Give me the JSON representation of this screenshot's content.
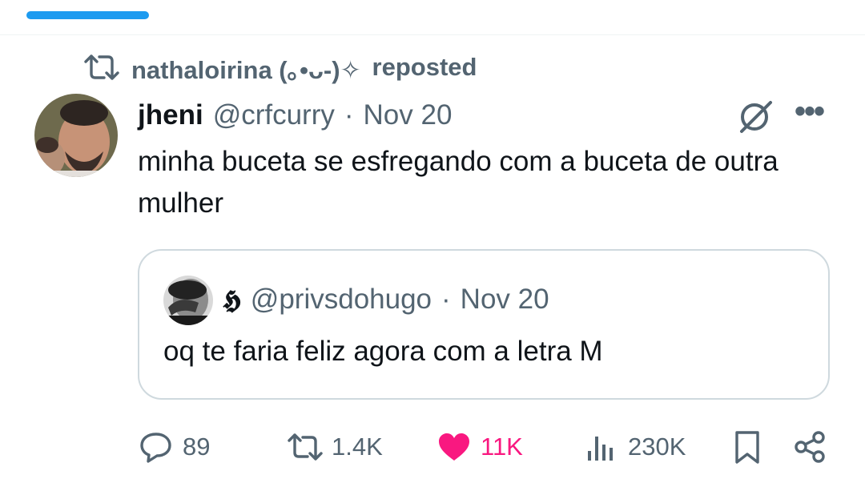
{
  "repost": {
    "reposter": "nathaloirina (｡•ᴗ-)✧",
    "label": "reposted"
  },
  "tweet": {
    "display_name": "jheni",
    "handle": "@crfcurry",
    "separator": "·",
    "date": "Nov 20",
    "text": "minha buceta se esfregando com a buceta de outra mulher",
    "more_label": "•••"
  },
  "quote": {
    "display_name": "𝕳",
    "handle": "@privsdohugo",
    "separator": "·",
    "date": "Nov 20",
    "text": "oq te faria feliz agora com a letra M"
  },
  "actions": {
    "replies": "89",
    "reposts": "1.4K",
    "likes": "11K",
    "views": "230K"
  },
  "colors": {
    "accent": "#1d9bf0",
    "like": "#f91880",
    "muted": "#536471",
    "border": "#cfd9de"
  },
  "icons": [
    "repost-icon",
    "grok-icon",
    "more-icon",
    "reply-icon",
    "like-icon",
    "views-icon",
    "bookmark-icon",
    "share-icon"
  ]
}
